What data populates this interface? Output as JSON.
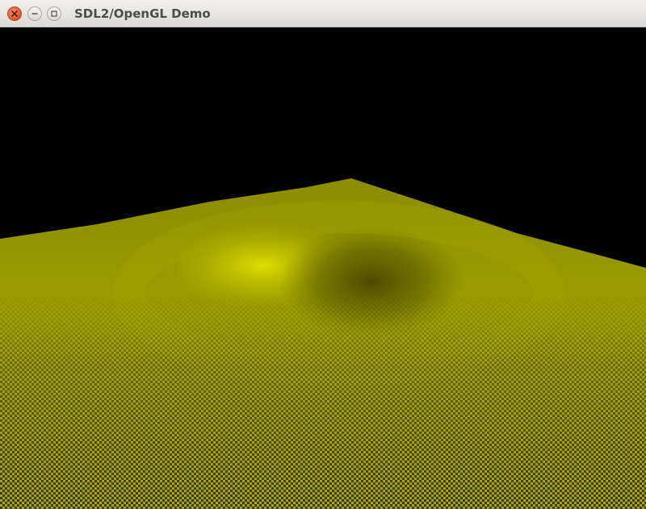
{
  "window": {
    "title": "SDL2/OpenGL Demo",
    "controls": {
      "close_icon": "close-icon",
      "minimize_icon": "minimize-icon",
      "maximize_icon": "maximize-icon"
    }
  },
  "scene": {
    "background_color": "#000000",
    "surface_color": "#9a9a00",
    "highlight_color": "#d6d600",
    "shadow_color": "#5a5a00",
    "pattern_dark_color": "#3a3a14",
    "pattern_light_color": "#a6a600"
  }
}
